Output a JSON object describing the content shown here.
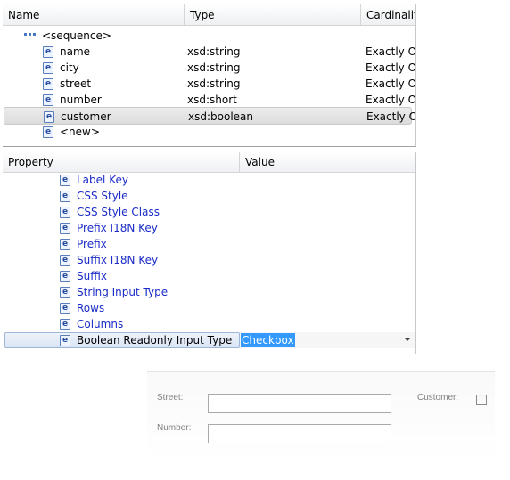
{
  "schema_table": {
    "columns": [
      "Name",
      "Type",
      "Cardinality"
    ],
    "sequence_label": "<sequence>",
    "rows": [
      {
        "name": "name",
        "type": "xsd:string",
        "cardinality": "Exactly On"
      },
      {
        "name": "city",
        "type": "xsd:string",
        "cardinality": "Exactly On"
      },
      {
        "name": "street",
        "type": "xsd:string",
        "cardinality": "Exactly On"
      },
      {
        "name": "number",
        "type": "xsd:short",
        "cardinality": "Exactly On"
      },
      {
        "name": "customer",
        "type": "xsd:boolean",
        "cardinality": "Exactly On"
      }
    ],
    "new_row_label": "<new>",
    "element_icon_glyph": "e"
  },
  "property_table": {
    "columns": [
      "Property",
      "Value"
    ],
    "rows": [
      "Label Key",
      "CSS Style",
      "CSS Style Class",
      "Prefix I18N Key",
      "Prefix",
      "Suffix I18N Key",
      "Suffix",
      "String Input Type",
      "Rows",
      "Columns"
    ],
    "selected_row": {
      "label": "Boolean Readonly Input Type",
      "value": "Checkbox"
    }
  },
  "form_preview": {
    "street_label": "Street:",
    "number_label": "Number:",
    "customer_label": "Customer:",
    "street_value": "",
    "number_value": "",
    "customer_checked": false
  },
  "colors": {
    "property_link": "#1a2bc8",
    "selection_highlight": "#3399ff",
    "element_icon_border": "#5a7fb8"
  }
}
